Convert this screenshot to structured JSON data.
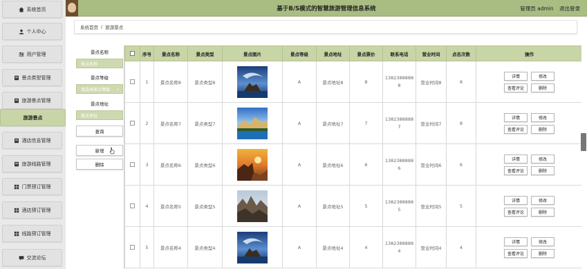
{
  "header": {
    "title": "基于B/S模式的智慧旅游管理信息系统",
    "user_label": "管理员 admin",
    "logout": "退出登录"
  },
  "sidebar": {
    "items": [
      {
        "label": "系统首页",
        "icon": "home-icon"
      },
      {
        "label": "个人中心",
        "icon": "person-icon"
      },
      {
        "label": "用户管理",
        "icon": "sliders-icon"
      },
      {
        "label": "景点类型管理",
        "icon": "doc-icon"
      },
      {
        "label": "旅游景点管理",
        "icon": "doc-icon"
      },
      {
        "label": "旅游景点",
        "icon": ""
      },
      {
        "label": "酒店信息管理",
        "icon": "doc-icon"
      },
      {
        "label": "旅游线路管理",
        "icon": "doc-icon"
      },
      {
        "label": "门票预订管理",
        "icon": "grid-icon"
      },
      {
        "label": "酒店预订管理",
        "icon": "grid-icon"
      },
      {
        "label": "线路预订管理",
        "icon": "grid-icon"
      },
      {
        "label": "交流论坛",
        "icon": "forum-icon"
      }
    ]
  },
  "breadcrumb": {
    "home": "系统首页",
    "separator": "/",
    "current": "旅游景点"
  },
  "search": {
    "name_label": "景点名称",
    "name_placeholder": "景点名称",
    "level_label": "景点等级",
    "level_placeholder": "请选择景点等级",
    "address_label": "景点地址",
    "address_placeholder": "景点地址",
    "query_button": "查询",
    "add_button": "新增",
    "delete_button": "删除"
  },
  "table": {
    "headers": [
      "",
      "序号",
      "景点名称",
      "景点类型",
      "景点图片",
      "景点等级",
      "景点地址",
      "景点票价",
      "联系电话",
      "营业时间",
      "点击次数",
      "操作"
    ],
    "actions": {
      "detail": "详情",
      "edit": "修改",
      "comments": "查看评论",
      "delete": "删除"
    },
    "rows": [
      {
        "index": "1",
        "name": "景点名称8",
        "type": "景点类型8",
        "image": "ocean-rock",
        "level": "A",
        "address": "景点地址8",
        "price": "8",
        "phone_a": "1382388888",
        "phone_b": "8",
        "hours": "营业时间8",
        "clicks": "8"
      },
      {
        "index": "2",
        "name": "景点名称7",
        "type": "景点类型7",
        "image": "lake-mountain",
        "level": "A",
        "address": "景点地址7",
        "price": "7",
        "phone_a": "1382388888",
        "phone_b": "7",
        "hours": "营业时间7",
        "clicks": "8"
      },
      {
        "index": "3",
        "name": "景点名称6",
        "type": "景点类型6",
        "image": "sunset-cliff",
        "level": "A",
        "address": "景点地址6",
        "price": "6",
        "phone_a": "1382388888",
        "phone_b": "6",
        "hours": "营业时间6",
        "clicks": "6"
      },
      {
        "index": "4",
        "name": "景点名称5",
        "type": "景点类型5",
        "image": "mountain-peaks",
        "level": "A",
        "address": "景点地址5",
        "price": "5",
        "phone_a": "1382388888",
        "phone_b": "5",
        "hours": "营业时间5",
        "clicks": "5"
      },
      {
        "index": "5",
        "name": "景点名称4",
        "type": "景点类型4",
        "image": "ocean-rock",
        "level": "A",
        "address": "景点地址4",
        "price": "4",
        "phone_a": "1382388888",
        "phone_b": "4",
        "hours": "营业时间4",
        "clicks": "4"
      }
    ]
  },
  "colors": {
    "accent": "#a9bd83",
    "accent_light": "#c8d5a6",
    "sidebar_bg": "#e9e9e9"
  }
}
